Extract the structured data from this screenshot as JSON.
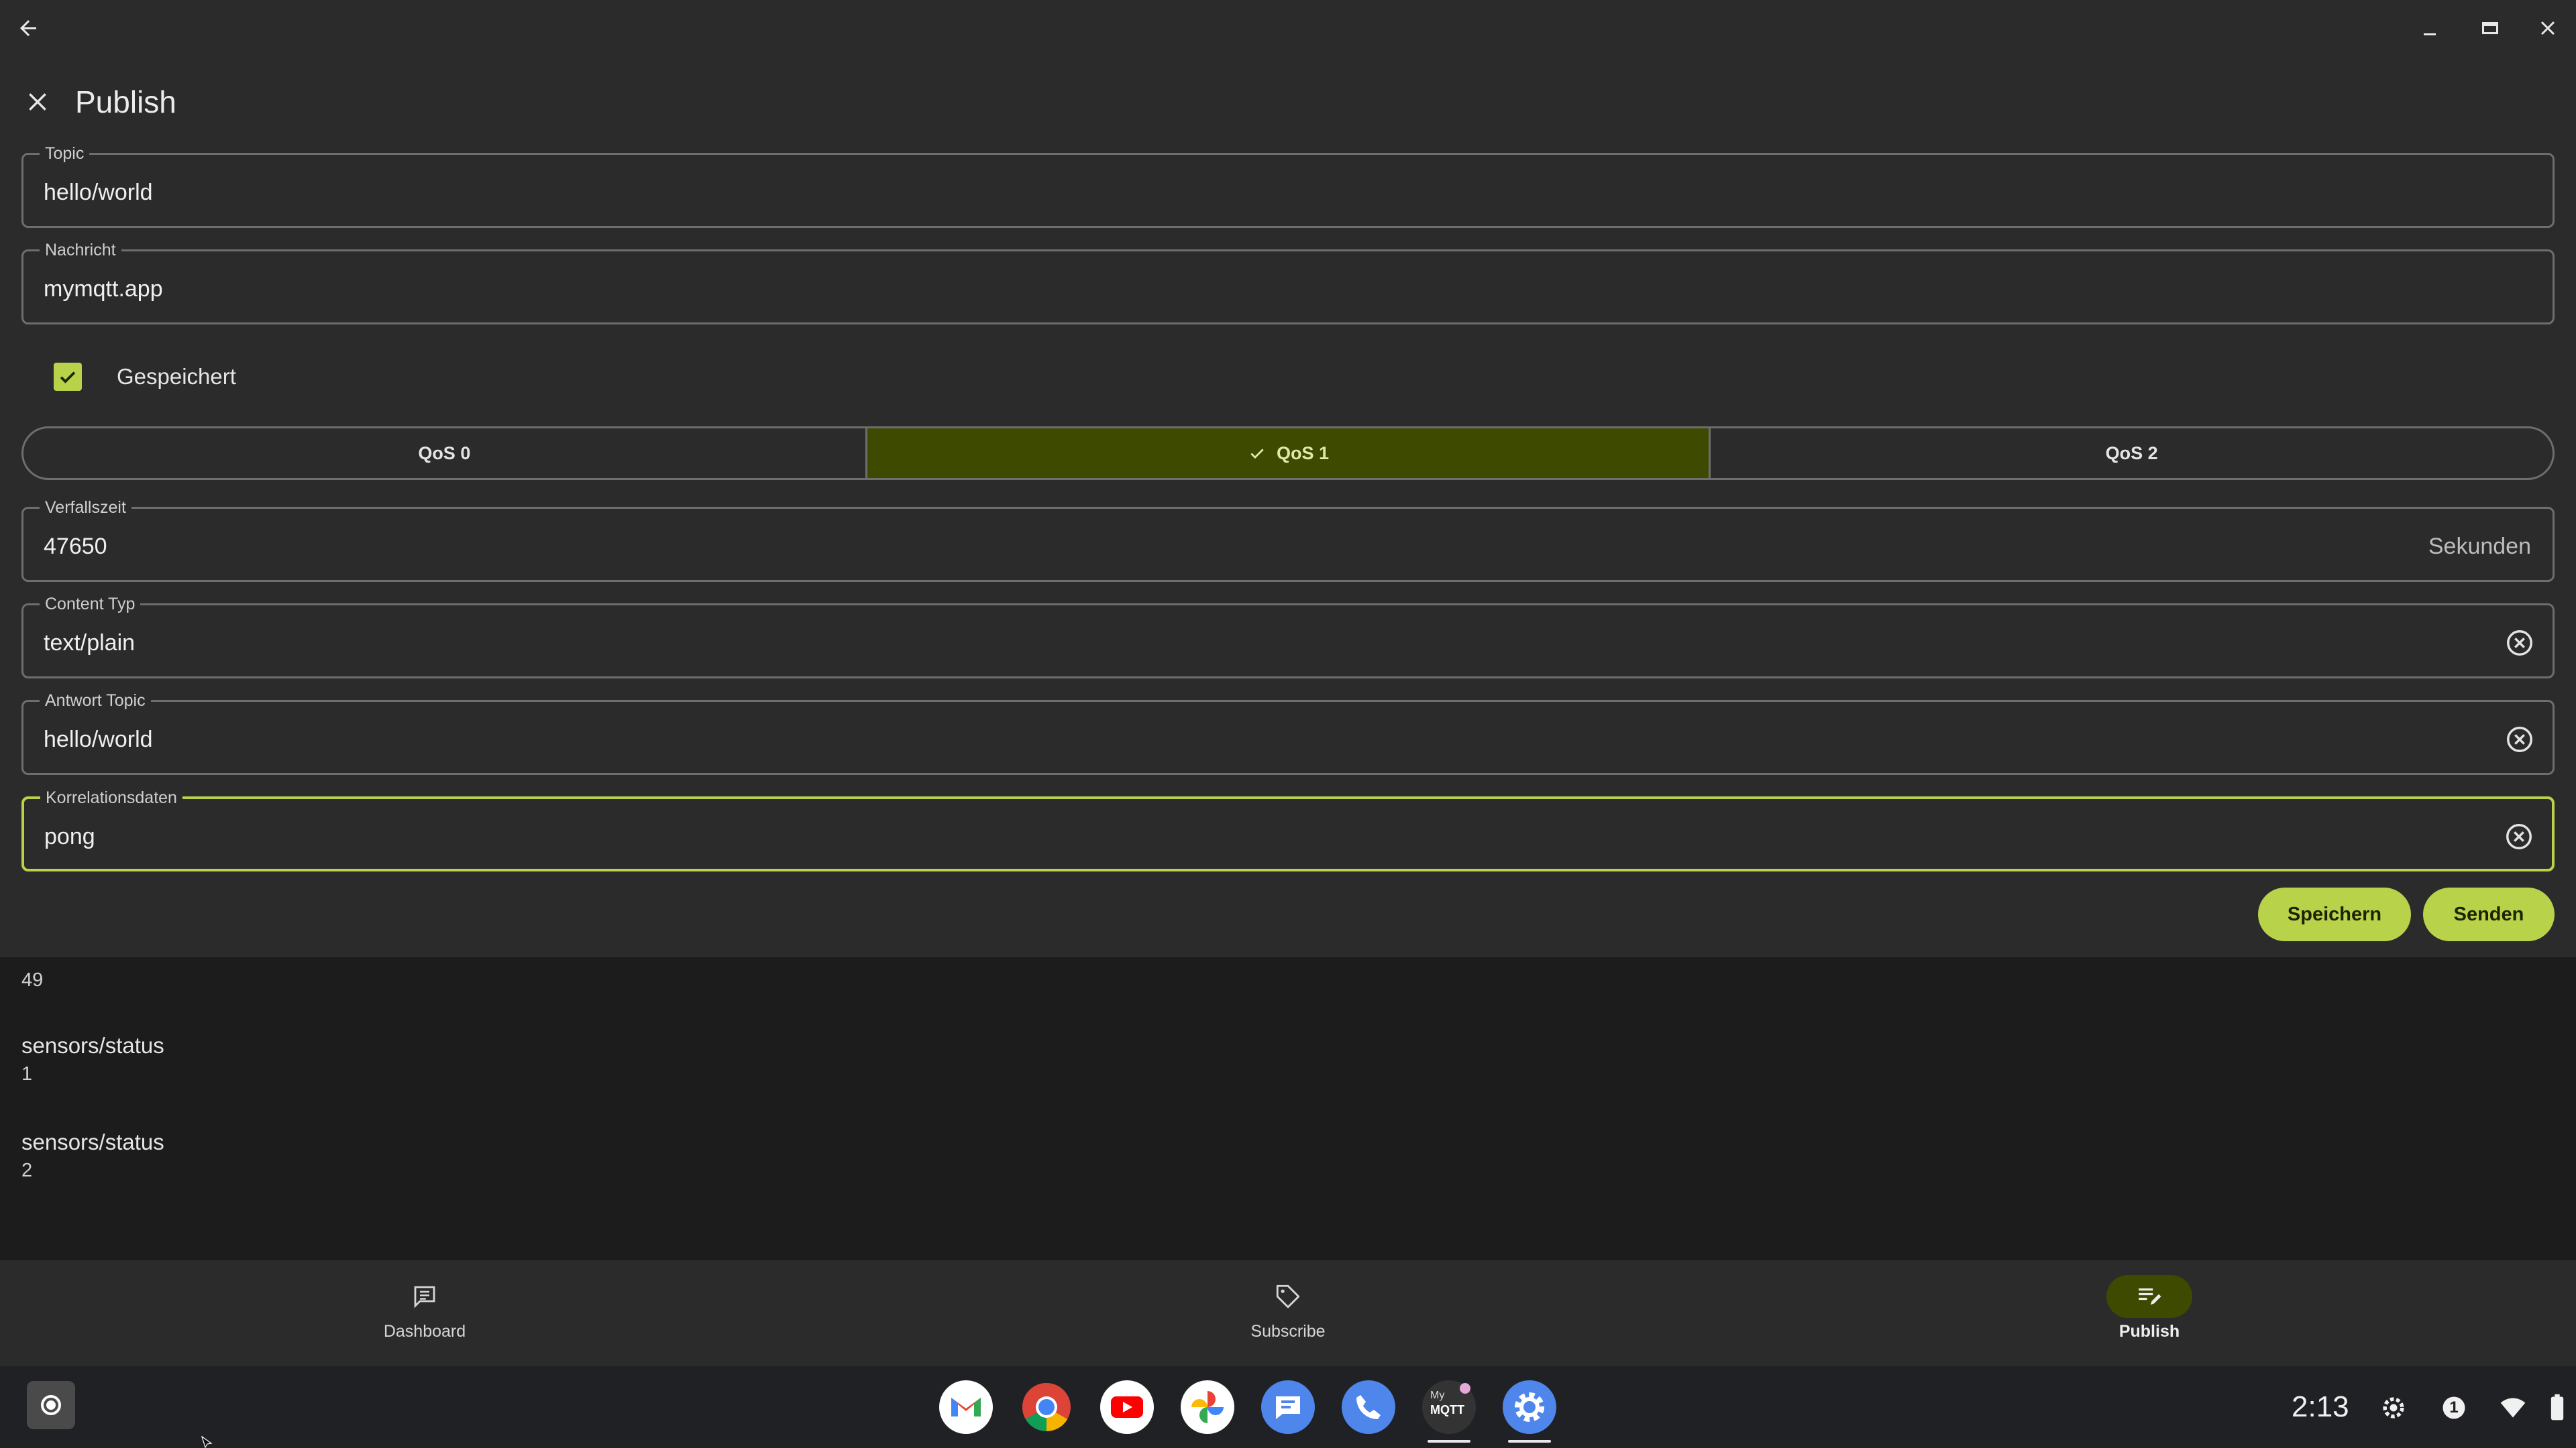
{
  "panel": {
    "title": "Publish"
  },
  "fields": {
    "topic": {
      "label": "Topic",
      "value": "hello/world"
    },
    "message": {
      "label": "Nachricht",
      "value": "mymqtt.app"
    },
    "expiry": {
      "label": "Verfallszeit",
      "value": "47650",
      "suffix": "Sekunden"
    },
    "content_type": {
      "label": "Content Typ",
      "value": "text/plain"
    },
    "response_topic": {
      "label": "Antwort Topic",
      "value": "hello/world"
    },
    "correlation": {
      "label": "Korrelationsdaten",
      "value": "pong"
    }
  },
  "retained": {
    "label": "Gespeichert",
    "checked": true
  },
  "qos": {
    "options": [
      "QoS 0",
      "QoS 1",
      "QoS 2"
    ],
    "selected": "QoS 1"
  },
  "actions": {
    "save_label": "Speichern",
    "send_label": "Senden"
  },
  "messages": [
    {
      "topic": "",
      "value": "49"
    },
    {
      "topic": "sensors/status",
      "value": "1"
    },
    {
      "topic": "sensors/status",
      "value": "2"
    }
  ],
  "bottom_nav": [
    {
      "label": "Dashboard",
      "icon": "dashboard-icon",
      "active": false
    },
    {
      "label": "Subscribe",
      "icon": "tag-icon",
      "active": false
    },
    {
      "label": "Publish",
      "icon": "publish-icon",
      "active": true
    }
  ],
  "shelf": {
    "apps": [
      "gmail-icon",
      "chrome-icon",
      "youtube-icon",
      "photos-icon",
      "messages-icon",
      "phone-icon",
      "mymqtt-icon",
      "settings-icon"
    ],
    "mymqtt_icon_text": {
      "line1": "My",
      "line2": "MQTT"
    },
    "clock": "2:13",
    "notification_count": "1"
  },
  "colors": {
    "accent": "#b8d24a",
    "selected_bg": "#3e4a00",
    "surface": "#2b2b2b",
    "background": "#1c1c1c"
  }
}
